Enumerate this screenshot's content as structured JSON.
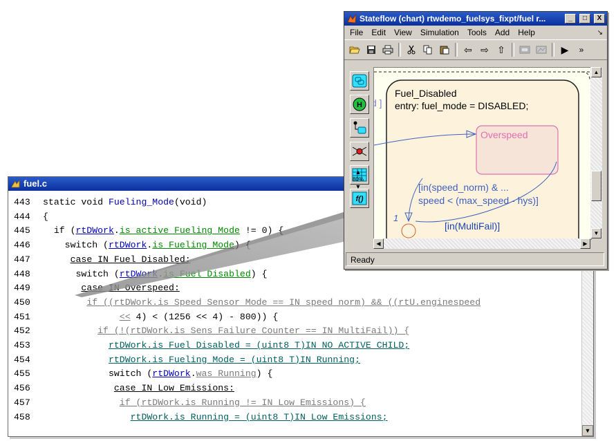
{
  "code_window": {
    "title": "fuel.c",
    "lines": [
      {
        "num": "443",
        "parts": [
          {
            "t": "static void ",
            "c": "kw"
          },
          {
            "t": "Fueling_Mode",
            "c": "fn"
          },
          {
            "t": "(void)",
            "c": "kw"
          }
        ]
      },
      {
        "num": "444",
        "parts": [
          {
            "t": "{",
            "c": "kw"
          }
        ]
      },
      {
        "num": "445",
        "parts": [
          {
            "t": "  if (",
            "c": "kw"
          },
          {
            "t": "rtDWork",
            "c": "lk"
          },
          {
            "t": ".",
            "c": "kw"
          },
          {
            "t": "is_active_Fueling_Mode",
            "c": "gr"
          },
          {
            "t": " != 0) {",
            "c": "kw"
          }
        ]
      },
      {
        "num": "446",
        "parts": [
          {
            "t": "    switch (",
            "c": "kw"
          },
          {
            "t": "rtDWork",
            "c": "lk"
          },
          {
            "t": ".",
            "c": "kw"
          },
          {
            "t": "is_Fueling_Mode",
            "c": "gr"
          },
          {
            "t": ") {",
            "c": "kw"
          }
        ]
      },
      {
        "num": "447",
        "parts": [
          {
            "t": "     ",
            "c": "kw"
          },
          {
            "t": "case IN_Fuel_Disabled:",
            "c": "ul"
          }
        ]
      },
      {
        "num": "448",
        "parts": [
          {
            "t": "      switch (",
            "c": "kw"
          },
          {
            "t": "rtDWork",
            "c": "lk"
          },
          {
            "t": ".",
            "c": "kw"
          },
          {
            "t": "is_Fuel_Disabled",
            "c": "gr"
          },
          {
            "t": ") {",
            "c": "kw"
          }
        ]
      },
      {
        "num": "449",
        "parts": [
          {
            "t": "       ",
            "c": "kw"
          },
          {
            "t": "case IN_Overspeed:",
            "c": "ul"
          }
        ]
      },
      {
        "num": "450",
        "parts": [
          {
            "t": "        ",
            "c": "kw"
          },
          {
            "t": "if ((rtDWork.is_Speed_Sensor_Mode == IN_speed_norm) && ((rtU.enginespeed",
            "c": "gy"
          }
        ]
      },
      {
        "num": "451",
        "parts": [
          {
            "t": "              ",
            "c": "kw"
          },
          {
            "t": "<<",
            "c": "gy"
          },
          {
            "t": " 4) < (1256 << 4) - 800)) {",
            "c": "kw"
          }
        ]
      },
      {
        "num": "452",
        "parts": [
          {
            "t": "          ",
            "c": "kw"
          },
          {
            "t": "if (!(rtDWork.is_Sens_Failure_Counter == IN_MultiFail)) {",
            "c": "gy"
          }
        ]
      },
      {
        "num": "453",
        "parts": [
          {
            "t": "            ",
            "c": "kw"
          },
          {
            "t": "rtDWork.is_Fuel_Disabled = (uint8_T)IN_NO_ACTIVE_CHILD;",
            "c": "tl"
          }
        ]
      },
      {
        "num": "454",
        "parts": [
          {
            "t": "            ",
            "c": "kw"
          },
          {
            "t": "rtDWork.is_Fueling_Mode = (uint8_T)IN_Running;",
            "c": "tl"
          }
        ]
      },
      {
        "num": "455",
        "parts": [
          {
            "t": "            switch (",
            "c": "kw"
          },
          {
            "t": "rtDWork",
            "c": "lk"
          },
          {
            "t": ".",
            "c": "kw"
          },
          {
            "t": "was_Running",
            "c": "gy"
          },
          {
            "t": ") {",
            "c": "kw"
          }
        ]
      },
      {
        "num": "456",
        "parts": [
          {
            "t": "             ",
            "c": "kw"
          },
          {
            "t": "case IN_Low_Emissions:",
            "c": "ul"
          }
        ]
      },
      {
        "num": "457",
        "parts": [
          {
            "t": "              ",
            "c": "kw"
          },
          {
            "t": "if (rtDWork.is_Running != IN_Low_Emissions) {",
            "c": "gy"
          }
        ]
      },
      {
        "num": "458",
        "parts": [
          {
            "t": "                ",
            "c": "kw"
          },
          {
            "t": "rtDWork.is_Running = (uint8_T)IN_Low_Emissions;",
            "c": "tl"
          }
        ]
      }
    ]
  },
  "stateflow": {
    "title": "Stateflow (chart) rtwdemo_fuelsys_fixpt/fuel r...",
    "window_buttons": {
      "minimize": "_",
      "maximize": "□",
      "close": "X"
    },
    "menu": [
      "File",
      "Edit",
      "View",
      "Simulation",
      "Tools",
      "Add",
      "Help"
    ],
    "menu_more": "↘",
    "toolbar_more": "»",
    "zoom_label": "80%",
    "state_main": {
      "name": "Fuel_Disabled",
      "entry": "entry: fuel_mode = DISABLED;"
    },
    "state_sub": {
      "name": "Overspeed"
    },
    "fragment_left": "d ]",
    "transition_label_1": "[in(speed_norm) & ...",
    "transition_label_2": "speed < (max_speed - hys)]",
    "transition_label_3": "[in(MultiFail)]",
    "transition_number": "1",
    "status": "Ready"
  },
  "colors": {
    "title_bar": "#1a44b5",
    "state_fill": "#fdf3dc",
    "substate_stroke": "#e070b0",
    "transition": "#4060c0"
  }
}
